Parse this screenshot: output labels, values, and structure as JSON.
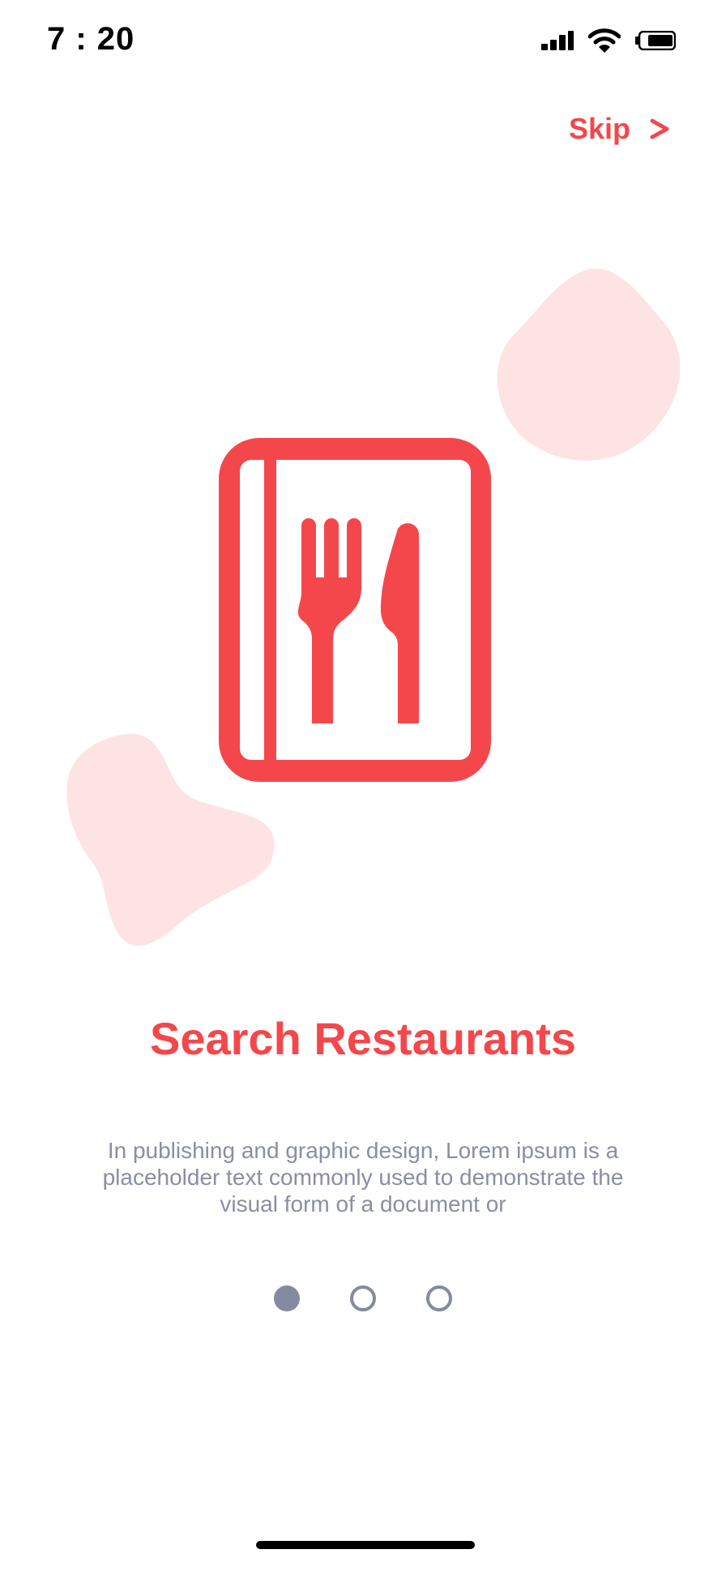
{
  "status_bar": {
    "time": "7 : 20",
    "icons": [
      "signal-icon",
      "wifi-icon",
      "battery-icon"
    ]
  },
  "header": {
    "skip_label": "Skip",
    "skip_icon": "chevron-right-icon"
  },
  "illustration": {
    "icon": "restaurant-menu-icon"
  },
  "content": {
    "title": "Search Restaurants",
    "description": "In publishing and graphic design, Lorem ipsum is a placeholder text commonly used to demonstrate the visual form of a document or"
  },
  "pager": {
    "total": 3,
    "active_index": 0
  },
  "colors": {
    "accent": "#F4474C",
    "blob": "#FDE3E4",
    "muted_text": "#8A8EA3",
    "dot": "#858AA0"
  }
}
